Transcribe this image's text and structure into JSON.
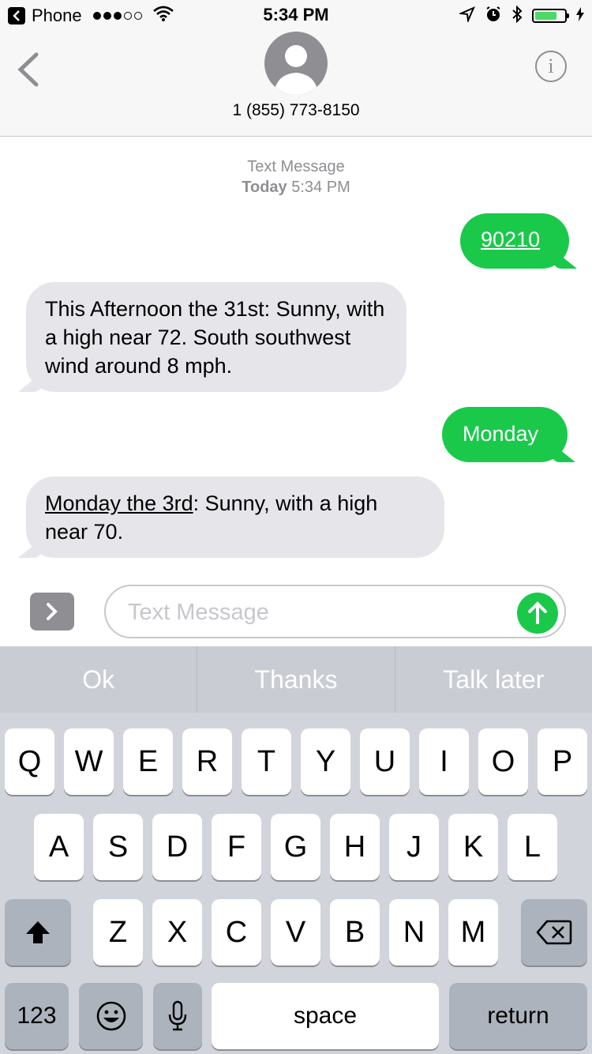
{
  "status_bar": {
    "carrier_app": "Phone",
    "signal_bars_filled": 3,
    "signal_bars_total": 5,
    "time": "5:34 PM",
    "battery_level_fraction": 0.75
  },
  "header": {
    "contact_number": "1 (855) 773-8150",
    "info_label": "i"
  },
  "conversation": {
    "meta_title": "Text Message",
    "meta_day": "Today",
    "meta_time": "5:34 PM",
    "messages": [
      {
        "direction": "outgoing",
        "text": "90210"
      },
      {
        "direction": "incoming",
        "text": "This Afternoon the 31st: Sunny, with a high near 72. South southwest wind around 8 mph."
      },
      {
        "direction": "outgoing",
        "text": "Monday"
      },
      {
        "direction": "incoming",
        "text_link": "Monday the 3rd",
        "text_rest": ": Sunny, with a high near 70."
      }
    ]
  },
  "input_bar": {
    "placeholder": "Text Message",
    "value": ""
  },
  "keyboard": {
    "predictions": [
      "Ok",
      "Thanks",
      "Talk later"
    ],
    "row1": [
      "Q",
      "W",
      "E",
      "R",
      "T",
      "Y",
      "U",
      "I",
      "O",
      "P"
    ],
    "row2": [
      "A",
      "S",
      "D",
      "F",
      "G",
      "H",
      "J",
      "K",
      "L"
    ],
    "row3": [
      "Z",
      "X",
      "C",
      "V",
      "B",
      "N",
      "M"
    ],
    "numbers_label": "123",
    "space_label": "space",
    "return_label": "return"
  },
  "colors": {
    "sms_green": "#1ac94a",
    "incoming_gray": "#e5e5ea",
    "keyboard_bg": "#d1d5db"
  }
}
